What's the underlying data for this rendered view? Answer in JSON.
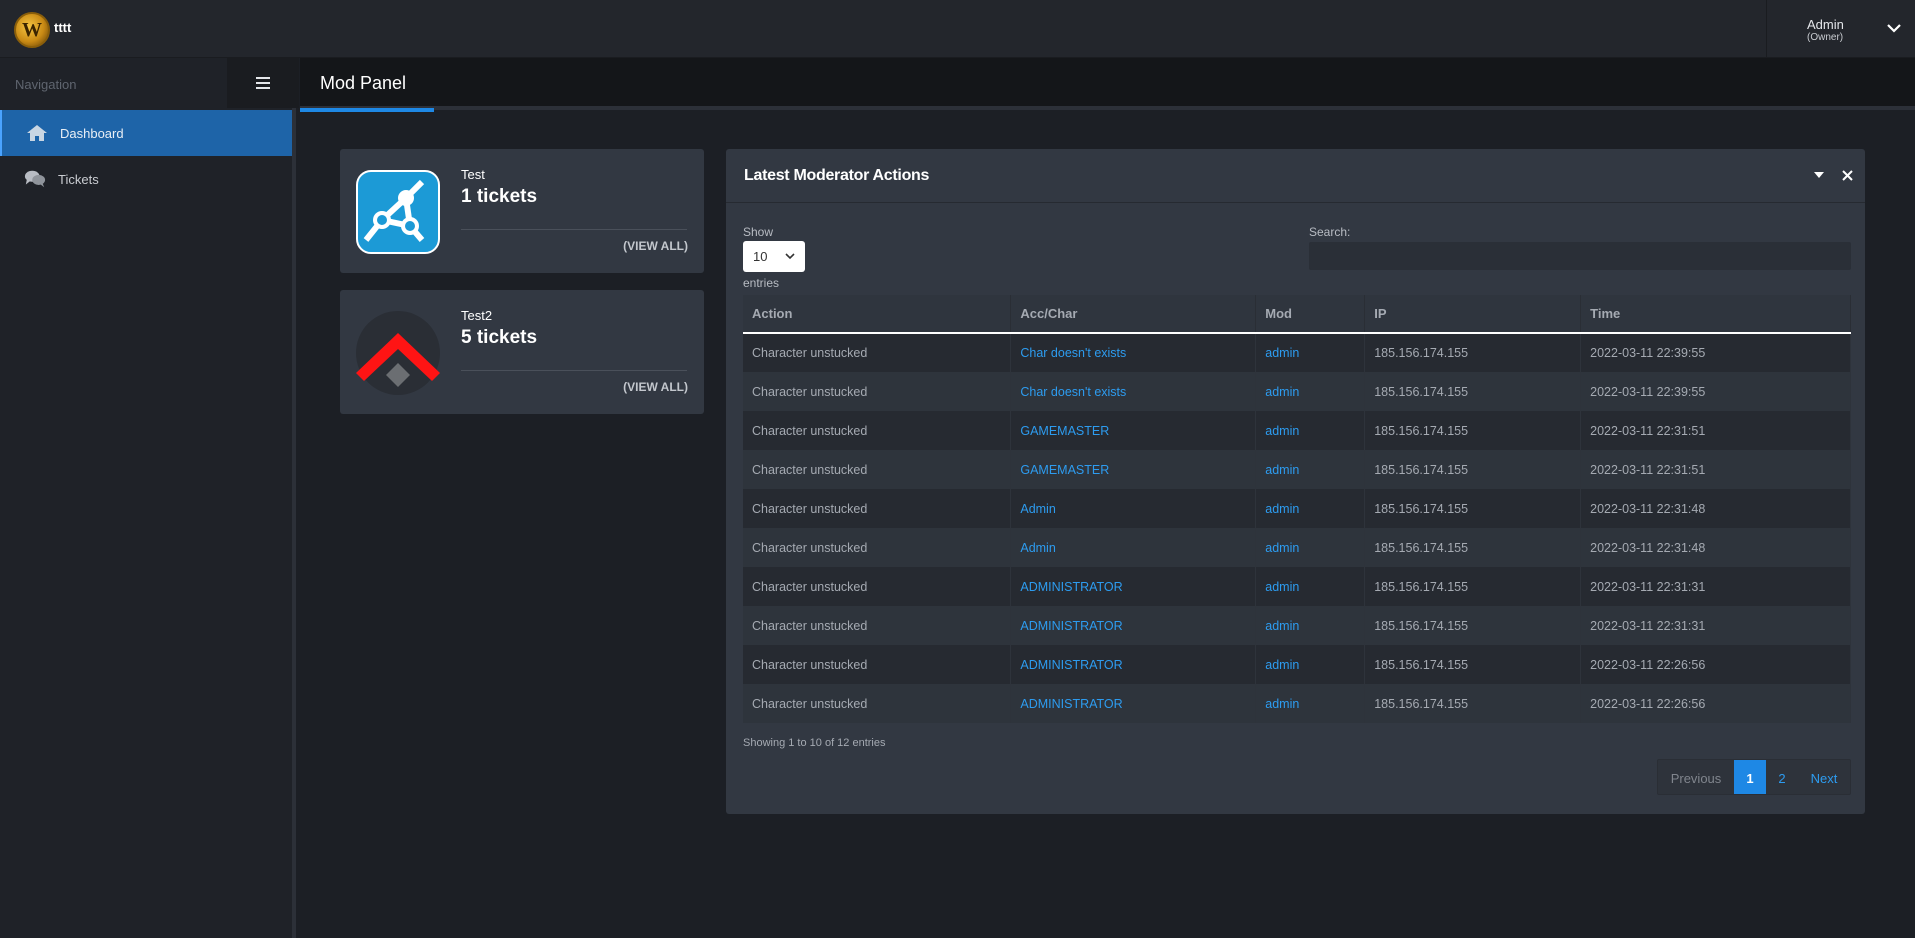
{
  "header": {
    "site_name": "tttt",
    "user_name": "Admin",
    "user_role": "(Owner)"
  },
  "sidebar": {
    "title": "Navigation",
    "items": [
      {
        "label": "Dashboard",
        "icon": "home-icon"
      },
      {
        "label": "Tickets",
        "icon": "comments-icon"
      }
    ]
  },
  "page": {
    "title": "Mod Panel"
  },
  "ticket_cards": [
    {
      "name": "Test",
      "count": "1 tickets",
      "view_all": "(VIEW ALL)",
      "icon": "network-icon"
    },
    {
      "name": "Test2",
      "count": "5 tickets",
      "view_all": "(VIEW ALL)",
      "icon": "chevron-diamond-icon"
    }
  ],
  "panel": {
    "title": "Latest Moderator Actions",
    "show_label": "Show",
    "entries_label": "entries",
    "length_value": "10",
    "search_label": "Search:",
    "search_value": "",
    "columns": [
      "Action",
      "Acc/Char",
      "Mod",
      "IP",
      "Time"
    ],
    "rows": [
      [
        "Character unstucked",
        "Char doesn't exists",
        "admin",
        "185.156.174.155",
        "2022-03-11 22:39:55"
      ],
      [
        "Character unstucked",
        "Char doesn't exists",
        "admin",
        "185.156.174.155",
        "2022-03-11 22:39:55"
      ],
      [
        "Character unstucked",
        "GAMEMASTER",
        "admin",
        "185.156.174.155",
        "2022-03-11 22:31:51"
      ],
      [
        "Character unstucked",
        "GAMEMASTER",
        "admin",
        "185.156.174.155",
        "2022-03-11 22:31:51"
      ],
      [
        "Character unstucked",
        "Admin",
        "admin",
        "185.156.174.155",
        "2022-03-11 22:31:48"
      ],
      [
        "Character unstucked",
        "Admin",
        "admin",
        "185.156.174.155",
        "2022-03-11 22:31:48"
      ],
      [
        "Character unstucked",
        "ADMINISTRATOR",
        "admin",
        "185.156.174.155",
        "2022-03-11 22:31:31"
      ],
      [
        "Character unstucked",
        "ADMINISTRATOR",
        "admin",
        "185.156.174.155",
        "2022-03-11 22:31:31"
      ],
      [
        "Character unstucked",
        "ADMINISTRATOR",
        "admin",
        "185.156.174.155",
        "2022-03-11 22:26:56"
      ],
      [
        "Character unstucked",
        "ADMINISTRATOR",
        "admin",
        "185.156.174.155",
        "2022-03-11 22:26:56"
      ]
    ],
    "info": "Showing 1 to 10 of 12 entries",
    "pagination": {
      "previous": "Previous",
      "pages": [
        "1",
        "2"
      ],
      "next": "Next"
    }
  },
  "colors": {
    "accent": "#1e88e5",
    "link": "#2d9cf0",
    "sidebar_active": "#1e64a8"
  }
}
